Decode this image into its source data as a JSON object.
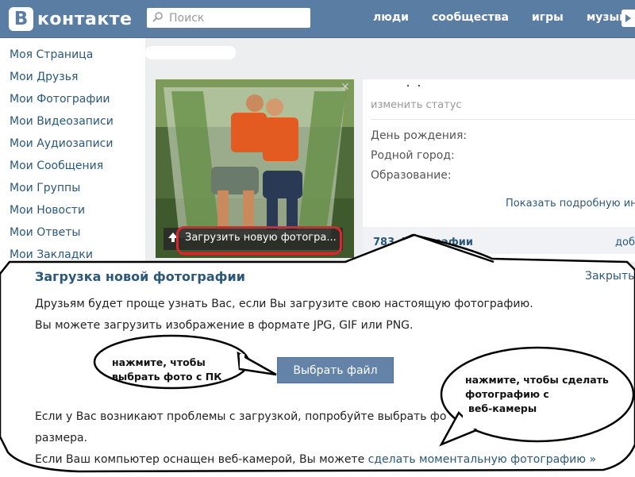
{
  "header": {
    "logo_letter": "B",
    "logo_text": "контакте",
    "search_placeholder": "Поиск",
    "nav": [
      "люди",
      "сообщества",
      "игры",
      "музыка"
    ]
  },
  "sidebar": {
    "items": [
      "Моя Страница",
      "Мои Друзья",
      "Мои Фотографии",
      "Мои Видеозаписи",
      "Мои Аудиозаписи",
      "Мои Сообщения",
      "Мои Группы",
      "Мои Новости",
      "Мои Ответы",
      "Мои Закладки"
    ]
  },
  "profile": {
    "upload_photo_label": "Загрузить новую фотогра...",
    "change_status": "изменить статус",
    "info_rows": [
      "День рождения:",
      "Родной город:",
      "Образование:"
    ],
    "show_more": "Показать подробную ин",
    "photos_count": "783 фотографии",
    "photos_add": "доб"
  },
  "dialog": {
    "title": "Загрузка новой фотографии",
    "close": "Закрыть",
    "line1": "Друзьям будет проще узнать Вас, если Вы загрузите свою настоящую фотографию.",
    "line2": "Вы можете загрузить изображение в формате JPG, GIF или PNG.",
    "choose_file": "Выбрать файл",
    "trouble_line1": "Если у Вас возникают проблемы с загрузкой, попробуйте выбрать фо",
    "trouble_line2": "размера.",
    "webcam_line_prefix": "Если Ваш компьютер оснащен веб-камерой, Вы можете ",
    "webcam_link": "сделать моментальную фотографию »"
  },
  "annotations": {
    "bubble_left_line1": "нажмите, чтобы",
    "bubble_left_line2": "выбрать фото с ПК",
    "bubble_right_line1": "нажмите, чтобы сделать",
    "bubble_right_line2": "фотографию с",
    "bubble_right_line3": "веб-камеры"
  },
  "colors": {
    "header": "#597da3",
    "link": "#2b587a",
    "highlight": "#e0232c",
    "button": "#6383a8"
  }
}
